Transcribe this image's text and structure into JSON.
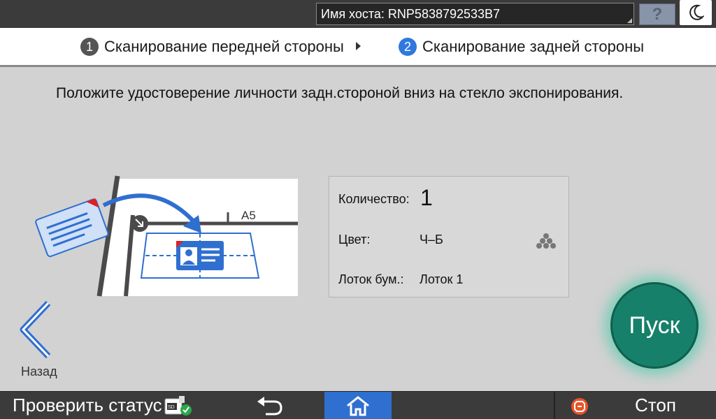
{
  "topbar": {
    "hostname": "Имя хоста: RNP5838792533B7",
    "help_label": "?",
    "night_icon": "moon-icon"
  },
  "steps": {
    "step1_num": "1",
    "step1_label": "Сканирование передней стороны",
    "step2_num": "2",
    "step2_label": "Сканирование задней стороны",
    "active_step": 2
  },
  "instruction": "Положите удостоверение личности задн.стороной вниз на стекло экспонирования.",
  "illustration": {
    "paper_size_label": "A5"
  },
  "info": {
    "quantity_label": "Количество:",
    "quantity_value": "1",
    "color_label": "Цвет:",
    "color_value": "Ч–Б",
    "tray_label": "Лоток бум.:",
    "tray_value": "Лоток 1"
  },
  "back_label": "Назад",
  "start_label": "Пуск",
  "bottombar": {
    "check_status": "Проверить статус",
    "stop_label": "Стоп"
  },
  "colors": {
    "accent_blue": "#2f6fd0",
    "start_green": "#17806a",
    "stop_orange": "#e8542a"
  }
}
